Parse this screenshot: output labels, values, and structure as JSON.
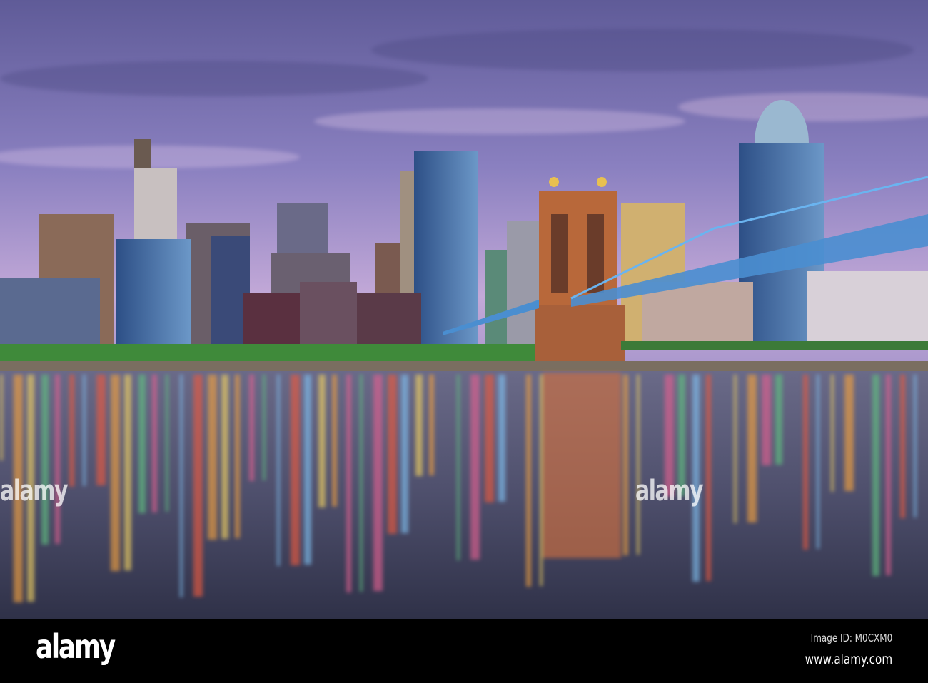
{
  "photo": {
    "subject": "city skyline",
    "colors": {
      "sky_top": "#6e6aa8",
      "sky_bottom": "#b9a6d6",
      "water": "#4d4e6a",
      "grass": "#3f8a3a",
      "bridge": "#5aa6e8",
      "tower": "#c0703a"
    }
  },
  "watermark": {
    "text": "alamy"
  },
  "footer": {
    "logo": "alamy",
    "image_id": "Image ID: M0CXM0",
    "website": "www.alamy.com"
  }
}
